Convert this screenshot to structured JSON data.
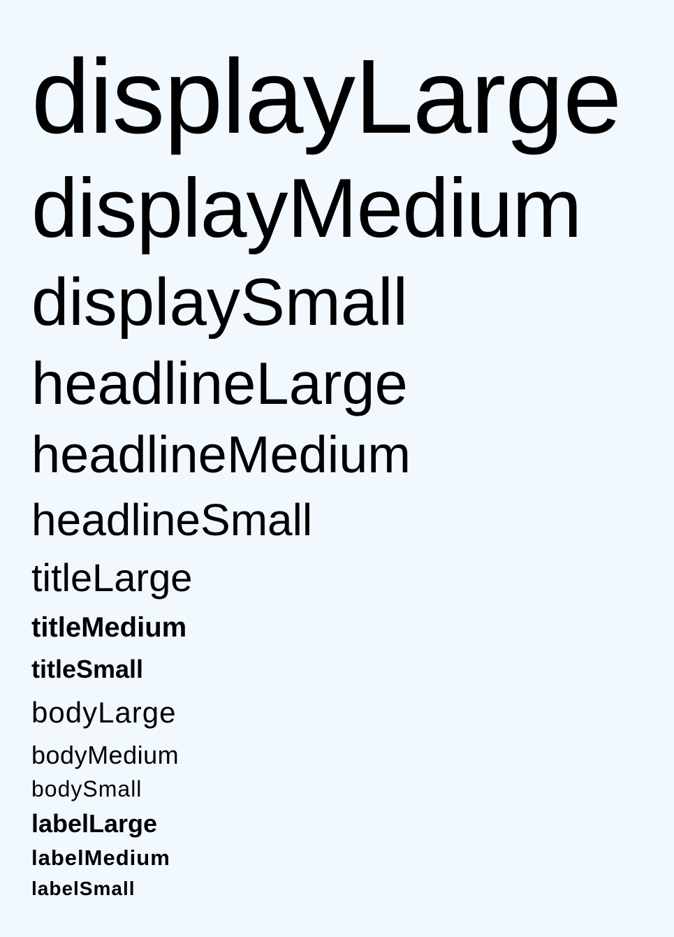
{
  "colors": {
    "background": "#f1f9ff",
    "text": "#000000"
  },
  "typography_samples": {
    "display_large": "displayLarge",
    "display_medium": "displayMedium",
    "display_small": "displaySmall",
    "headline_large": "headlineLarge",
    "headline_medium": "headlineMedium",
    "headline_small": "headlineSmall",
    "title_large": "titleLarge",
    "title_medium": "titleMedium",
    "title_small": "titleSmall",
    "body_large": "bodyLarge",
    "body_medium": "bodyMedium",
    "body_small": "bodySmall",
    "label_large": "labelLarge",
    "label_medium": "labelMedium",
    "label_small": "labelSmall"
  }
}
